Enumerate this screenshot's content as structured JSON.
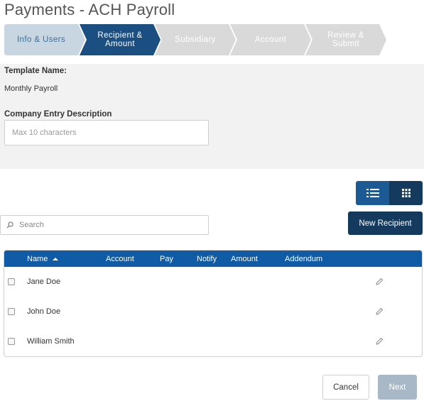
{
  "page": {
    "title": "Payments - ACH Payroll"
  },
  "stepper": {
    "steps": [
      {
        "label_line1": "Info & Users",
        "label_line2": "",
        "state": "completed"
      },
      {
        "label_line1": "Recipient &",
        "label_line2": "Amount",
        "state": "active"
      },
      {
        "label_line1": "Subsidiary",
        "label_line2": "",
        "state": "pending"
      },
      {
        "label_line1": "Account",
        "label_line2": "",
        "state": "pending"
      },
      {
        "label_line1": "Review &",
        "label_line2": "Submit",
        "state": "pending"
      }
    ],
    "colors": {
      "completed": "#c8d6e2",
      "active": "#1b4f82",
      "pending": "#d9d9d9"
    }
  },
  "form": {
    "template_label": "Template Name:",
    "template_value": "Monthly Payroll",
    "company_entry_label": "Company Entry Description",
    "company_entry_placeholder": "Max 10 characters"
  },
  "toolbar": {
    "list_view_icon": "list-icon",
    "grid_view_icon": "grid-icon",
    "search_placeholder": "Search",
    "new_recipient_label": "New Recipient"
  },
  "table": {
    "headers": {
      "name": "Name",
      "account": "Account",
      "pay": "Pay",
      "notify": "Notify",
      "amount": "Amount",
      "addendum": "Addendum"
    },
    "sort": "ascending",
    "rows": [
      {
        "name": "Jane Doe"
      },
      {
        "name": "John Doe"
      },
      {
        "name": "William Smith"
      }
    ]
  },
  "footer": {
    "cancel_label": "Cancel",
    "next_label": "Next"
  },
  "colors": {
    "header_blue": "#0f5ba5",
    "primary_dark": "#143b5e",
    "disabled_button": "#a9b8c6"
  }
}
